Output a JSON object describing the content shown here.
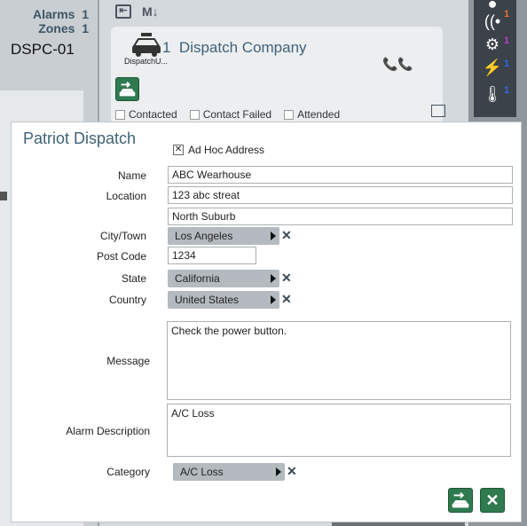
{
  "left_panel": {
    "alarms_label": "Alarms",
    "alarms_count": "1",
    "zones_label": "Zones",
    "zones_count": "1",
    "site_code": "DSPC-01"
  },
  "dispatch_card": {
    "icon_label": "DispatchU...",
    "number": "1",
    "company": "Dispatch Company",
    "status_options": [
      "Contacted",
      "Contact Failed",
      "Attended"
    ]
  },
  "right_panel": {
    "badges": [
      {
        "icon": "signal-icon",
        "value": "1",
        "color": "#e8722a"
      },
      {
        "icon": "gear-icon",
        "value": "1",
        "color": "#c03ad0"
      },
      {
        "icon": "lightning-icon",
        "value": "1",
        "color": "#2a6ee8"
      },
      {
        "icon": "thermometer-icon",
        "value": "1",
        "color": "#2a6ee8"
      }
    ]
  },
  "dialog": {
    "title": "Patriot Dispatch",
    "adhoc_label": "Ad Hoc Address",
    "adhoc_checked": true,
    "labels": {
      "name": "Name",
      "location": "Location",
      "city": "City/Town",
      "postcode": "Post Code",
      "state": "State",
      "country": "Country",
      "message": "Message",
      "alarm_description": "Alarm Description",
      "category": "Category"
    },
    "values": {
      "name": "ABC Wearhouse",
      "location_line1": "123 abc streat",
      "location_line2": "North Suburb",
      "city": "Los Angeles",
      "postcode": "1234",
      "state": "California",
      "country": "United States",
      "message": "Check the power button.",
      "alarm_description": "A/C Loss",
      "category": "A/C Loss"
    }
  },
  "colors": {
    "accent": "#3e6278",
    "button_green": "#2f7a4f"
  }
}
